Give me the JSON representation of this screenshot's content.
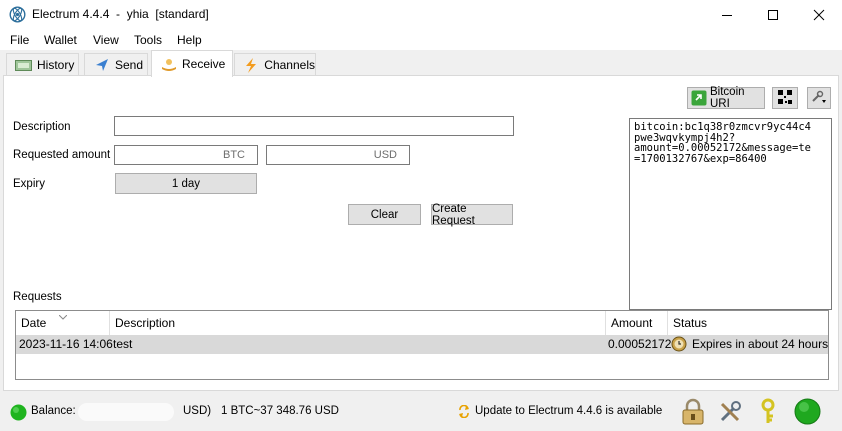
{
  "window": {
    "title": "Electrum 4.4.4  -  yhia  [standard]",
    "minimize": "minimize",
    "maximize": "maximize",
    "close": "close"
  },
  "menu": [
    "File",
    "Wallet",
    "View",
    "Tools",
    "Help"
  ],
  "tabs": [
    {
      "label": "History",
      "icon": "history-icon"
    },
    {
      "label": "Send",
      "icon": "send-icon"
    },
    {
      "label": "Receive",
      "icon": "receive-icon",
      "active": true
    },
    {
      "label": "Channels",
      "icon": "lightning-icon"
    }
  ],
  "receive": {
    "description_label": "Description",
    "description_value": "",
    "amount_label": "Requested amount",
    "btc_unit": "BTC",
    "usd_unit": "USD",
    "expiry_label": "Expiry",
    "expiry_value": "1 day",
    "clear_button": "Clear",
    "create_button": "Create Request",
    "bitcoin_uri_button": "Bitcoin URI",
    "uri_text": "bitcoin:bc1q38r0zmcvr9yc44c4\npwe3wqvkympj4h2?\namount=0.00052172&message=te\n=1700132767&exp=86400"
  },
  "requests": {
    "label": "Requests",
    "columns": [
      "Date",
      "Description",
      "Amount",
      "Status"
    ],
    "rows": [
      {
        "date": "2023-11-16 14:06",
        "description": "test",
        "amount": "0.00052172",
        "status": "Expires in about 24 hours"
      }
    ]
  },
  "status": {
    "balance_prefix": "Balance:",
    "balance_suffix": "USD)",
    "rate": "1 BTC~37 348.76 USD",
    "update_text": "Update to Electrum 4.4.6 is available"
  },
  "colors": {
    "accent_green": "#1fb41f",
    "update_orange": "#e8a200",
    "selection_gray": "#d9d9d9"
  }
}
